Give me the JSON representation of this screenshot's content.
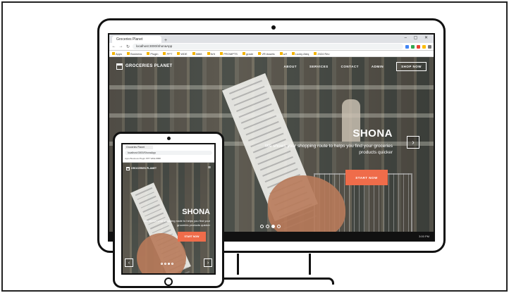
{
  "desktop": {
    "browser": {
      "tab_title": "Groceries Planet",
      "new_tab": "+",
      "window_controls": "– ▢ ✕",
      "back": "←",
      "forward": "→",
      "reload": "↻",
      "url": "localhost:3000/ShonaApp",
      "bookmarks": [
        "Apps",
        "Business",
        "Plugin",
        "PPT",
        "WDE",
        "8888",
        "Nrfr",
        "PROMPTS",
        "grade",
        "VR Assets",
        "w/f",
        "Lucky Ateq",
        "2024 Rev"
      ]
    },
    "site": {
      "logo_text": "GROCERIES PLANET",
      "nav": {
        "about": "ABOUT",
        "services": "SERVICES",
        "contact": "CONTACT",
        "admin": "ADMIN",
        "cta": "SHOP NOW"
      },
      "hero_title": "SHONA",
      "hero_subtitle": "We shows your shopping route to helps you find your groceries products quicker",
      "hero_button": "START NOW",
      "next_arrow": "›"
    },
    "taskbar": {
      "clock": "3:00 PM"
    }
  },
  "tablet": {
    "browser": {
      "tab_title": "Groceries Planet",
      "url": "localhost:3000/ShonaApp",
      "bookmarks": "Apps  Business  Plugin  PPT  WDE  8888"
    },
    "site": {
      "logo_text": "GROCERIES PLANET",
      "menu_icon": "≡",
      "hero_title": "SHONA",
      "hero_subtitle": "We shows your shopping route to helps you find your groceries products quicker",
      "hero_button": "START NOW",
      "prev_arrow": "‹",
      "next_arrow": "›"
    }
  },
  "colors": {
    "accent": "#ef6c4a",
    "device_outline": "#111111",
    "taskbar": "#111111"
  }
}
